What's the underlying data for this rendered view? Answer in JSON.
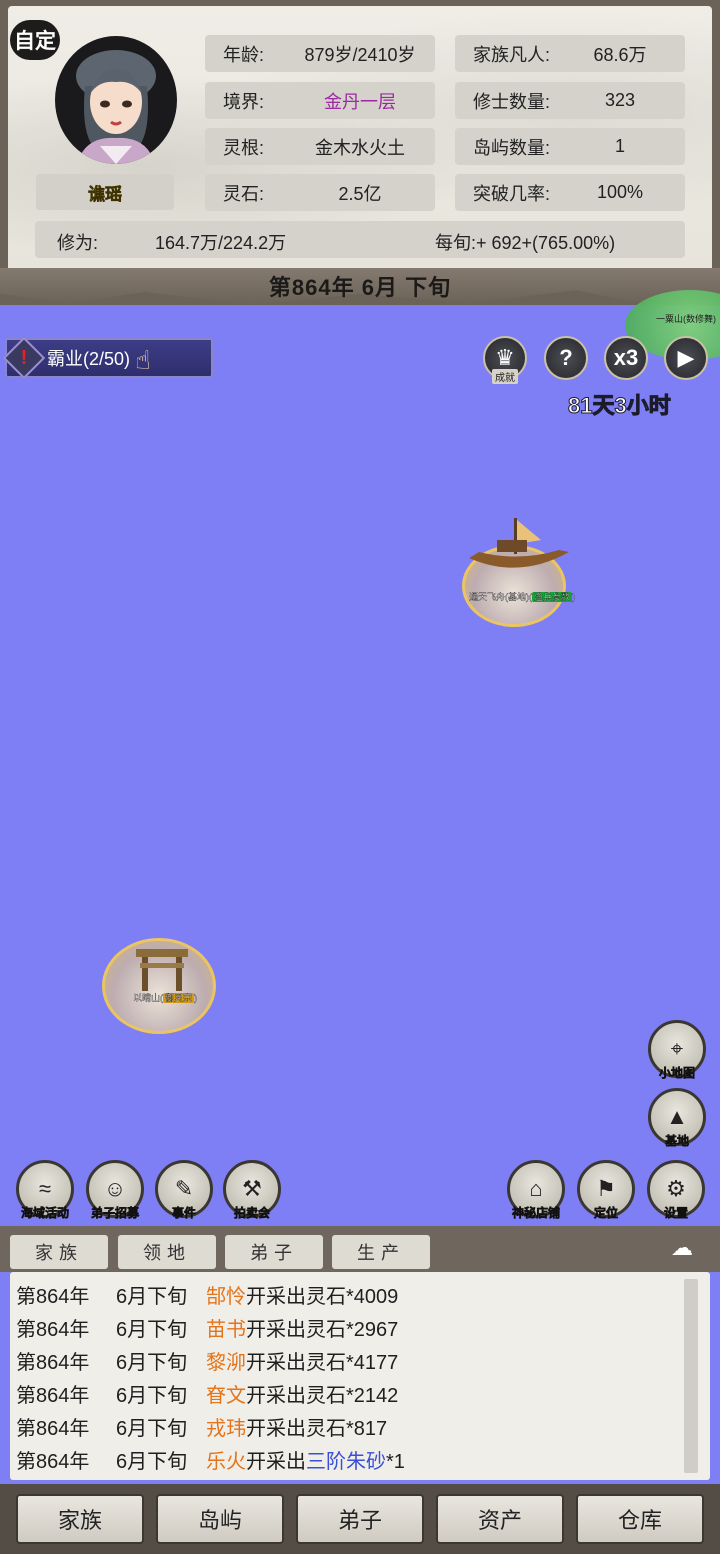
{
  "header": {
    "custom_label": "自定",
    "player_name": "谯瑶",
    "stats_left": [
      {
        "label": "年龄:",
        "value": "879岁/2410岁"
      },
      {
        "label": "境界:",
        "value": "金丹一层"
      },
      {
        "label": "灵根:",
        "value": "金木水火土"
      },
      {
        "label": "灵石:",
        "value": "2.5亿"
      }
    ],
    "stats_right": [
      {
        "label": "家族凡人:",
        "value": "68.6万"
      },
      {
        "label": "修士数量:",
        "value": "323"
      },
      {
        "label": "岛屿数量:",
        "value": "1"
      },
      {
        "label": "突破几率:",
        "value": "100%"
      }
    ],
    "cultivation": {
      "label": "修为:",
      "value": "164.7万/224.2万",
      "rate": "每旬:+ 692+(765.00%)"
    },
    "date": "第864年 6月 下旬"
  },
  "map": {
    "quest": "霸业(2/50)",
    "top_buttons": {
      "achievement_cap": "成就",
      "help": "?",
      "speed": "x3",
      "play": "▶"
    },
    "timer": "81天3小时",
    "islands": [
      {
        "name": "通天飞舟(基地)",
        "tag": "渔兵参数",
        "tag_color": "#18a238"
      },
      {
        "name": "以晴山",
        "tag": "御灵宗",
        "tag_color": "#d29a18"
      },
      {
        "name": "一粟山",
        "tag": "数修舞"
      }
    ],
    "right_tools": [
      {
        "label": "小地图",
        "icon": "map-pin-icon"
      },
      {
        "label": "基地",
        "icon": "mountain-icon"
      }
    ],
    "bottom_left_tools": [
      {
        "label": "海域活动",
        "icon": "wave-icon"
      },
      {
        "label": "弟子招募",
        "icon": "person-icon"
      },
      {
        "label": "事件",
        "icon": "scroll-icon"
      },
      {
        "label": "拍卖会",
        "icon": "gavel-icon"
      }
    ],
    "bottom_right_tools": [
      {
        "label": "神秘店铺",
        "icon": "shop-icon"
      },
      {
        "label": "定位",
        "icon": "flag-icon"
      },
      {
        "label": "设置",
        "icon": "gear-icon"
      }
    ]
  },
  "log": {
    "tabs": [
      "家族",
      "领地",
      "弟子",
      "生产"
    ],
    "rows": [
      {
        "year": "第864年",
        "month": "6月下旬",
        "name": "郜怜",
        "action": "开采出灵石*4009",
        "item": "",
        "suffix": ""
      },
      {
        "year": "第864年",
        "month": "6月下旬",
        "name": "苗书",
        "action": "开采出灵石*2967",
        "item": "",
        "suffix": ""
      },
      {
        "year": "第864年",
        "month": "6月下旬",
        "name": "黎泖",
        "action": "开采出灵石*4177",
        "item": "",
        "suffix": ""
      },
      {
        "year": "第864年",
        "month": "6月下旬",
        "name": "眘文",
        "action": "开采出灵石*2142",
        "item": "",
        "suffix": ""
      },
      {
        "year": "第864年",
        "month": "6月下旬",
        "name": "戎玮",
        "action": "开采出灵石*817",
        "item": "",
        "suffix": ""
      },
      {
        "year": "第864年",
        "month": "6月下旬",
        "name": "乐火",
        "action": "开采出",
        "item": "三阶朱砂",
        "suffix": "*1"
      }
    ]
  },
  "nav": [
    "家族",
    "岛屿",
    "弟子",
    "资产",
    "仓库"
  ],
  "colors": {
    "sea": "#7f7ff5",
    "panel": "#efede6",
    "name_highlight": "#e5731a",
    "item_highlight": "#3a4fd8",
    "realm": "#9b2aa0"
  }
}
